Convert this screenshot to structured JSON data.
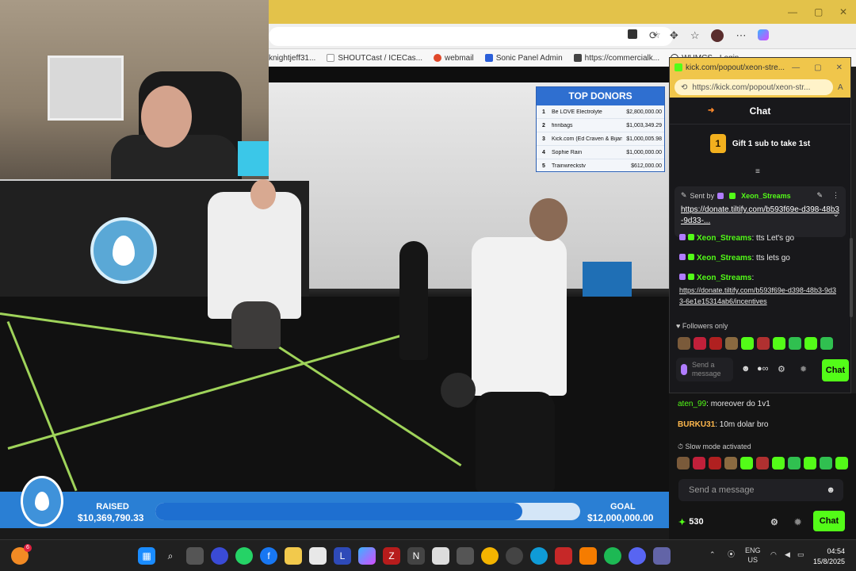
{
  "browser": {
    "bookmarks": [
      "knightjeff31...",
      "SHOUTCast / ICECas...",
      "webmail",
      "Sonic Panel Admin",
      "https://commercialk...",
      "WHMCS - Login"
    ]
  },
  "donors": {
    "title": "TOP DONORS",
    "rows": [
      {
        "rank": "1",
        "name": "Be LOVE Electrolyte",
        "amount": "$2,800,000.00"
      },
      {
        "rank": "2",
        "name": "finnbags",
        "amount": "$1,003,349.29"
      },
      {
        "rank": "3",
        "name": "Kick.com (Ed Craven & Bijan Te...",
        "amount": "$1,000,005.98"
      },
      {
        "rank": "4",
        "name": "Sophie Rain",
        "amount": "$1,000,000.00"
      },
      {
        "rank": "5",
        "name": "Trainwreckstv",
        "amount": "$612,000.00"
      }
    ]
  },
  "fundraiser": {
    "raised_label": "RAISED",
    "raised_value": "$10,369,790.33",
    "goal_label": "GOAL",
    "goal_value": "$12,000,000.00",
    "progress_fraction": 0.864
  },
  "popout": {
    "title": "kick.com/popout/xeon-stre...",
    "url": "https://kick.com/popout/xeon-str...",
    "chat_title": "Chat",
    "gift_badge": "1",
    "gift_text": "Gift 1 sub to take 1st",
    "pinned_sent_by": "Sent by",
    "pinned_user": "Xeon_Streams",
    "pinned_link": "https://donate.tiltify.com/b593f69e-d398-48b3-9d33-...",
    "messages": [
      {
        "user": "Xeon_Streams",
        "text": ": tts Let's go"
      },
      {
        "user": "Xeon_Streams",
        "text": ": tts lets go"
      },
      {
        "user": "Xeon_Streams",
        "text": ":"
      }
    ],
    "long_link": "https://donate.tiltify.com/b593f69e-d398-48b3-9d33-6e1e15314ab6/incentives",
    "followers_only": "Followers only",
    "input_placeholder": "Send a message",
    "chat_button": "Chat"
  },
  "mainchat": {
    "messages": [
      {
        "user": "aten_99",
        "text": ": moreover do 1v1"
      },
      {
        "user": "BURKU31",
        "text": ": 10m dolar bro"
      }
    ],
    "slow_mode": "Slow mode activated",
    "input_placeholder": "Send a message",
    "points": "530",
    "chat_button": "Chat"
  },
  "taskbar": {
    "lang1": "ENG",
    "lang2": "US",
    "time": "04:54",
    "date": "15/8/2025",
    "notification_count": "6"
  },
  "colors": {
    "kick_green": "#53fc18",
    "fundraiser_blue": "#2a7fd4",
    "browser_yellow": "#e3c24a"
  }
}
